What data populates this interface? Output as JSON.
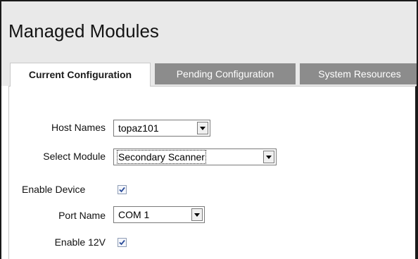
{
  "page": {
    "title": "Managed Modules"
  },
  "tabs": [
    {
      "label": "Current Configuration",
      "active": true
    },
    {
      "label": "Pending Configuration",
      "active": false
    },
    {
      "label": "System Resources",
      "active": false
    }
  ],
  "form": {
    "host_names": {
      "label": "Host Names",
      "value": "topaz101"
    },
    "select_module": {
      "label": "Select Module",
      "value": "Secondary Scanner"
    },
    "enable_device": {
      "label": "Enable Device",
      "checked": true
    },
    "port_name": {
      "label": "Port Name",
      "value": "COM 1"
    },
    "enable_12v": {
      "label": "Enable 12V",
      "checked": true
    }
  },
  "colors": {
    "header_bg": "#e9e9e9",
    "inactive_tab_bg": "#8c8c8c",
    "checkmark": "#2a4c9a"
  },
  "icons": {
    "dropdown": "chevron-down-icon",
    "check": "check-icon"
  }
}
